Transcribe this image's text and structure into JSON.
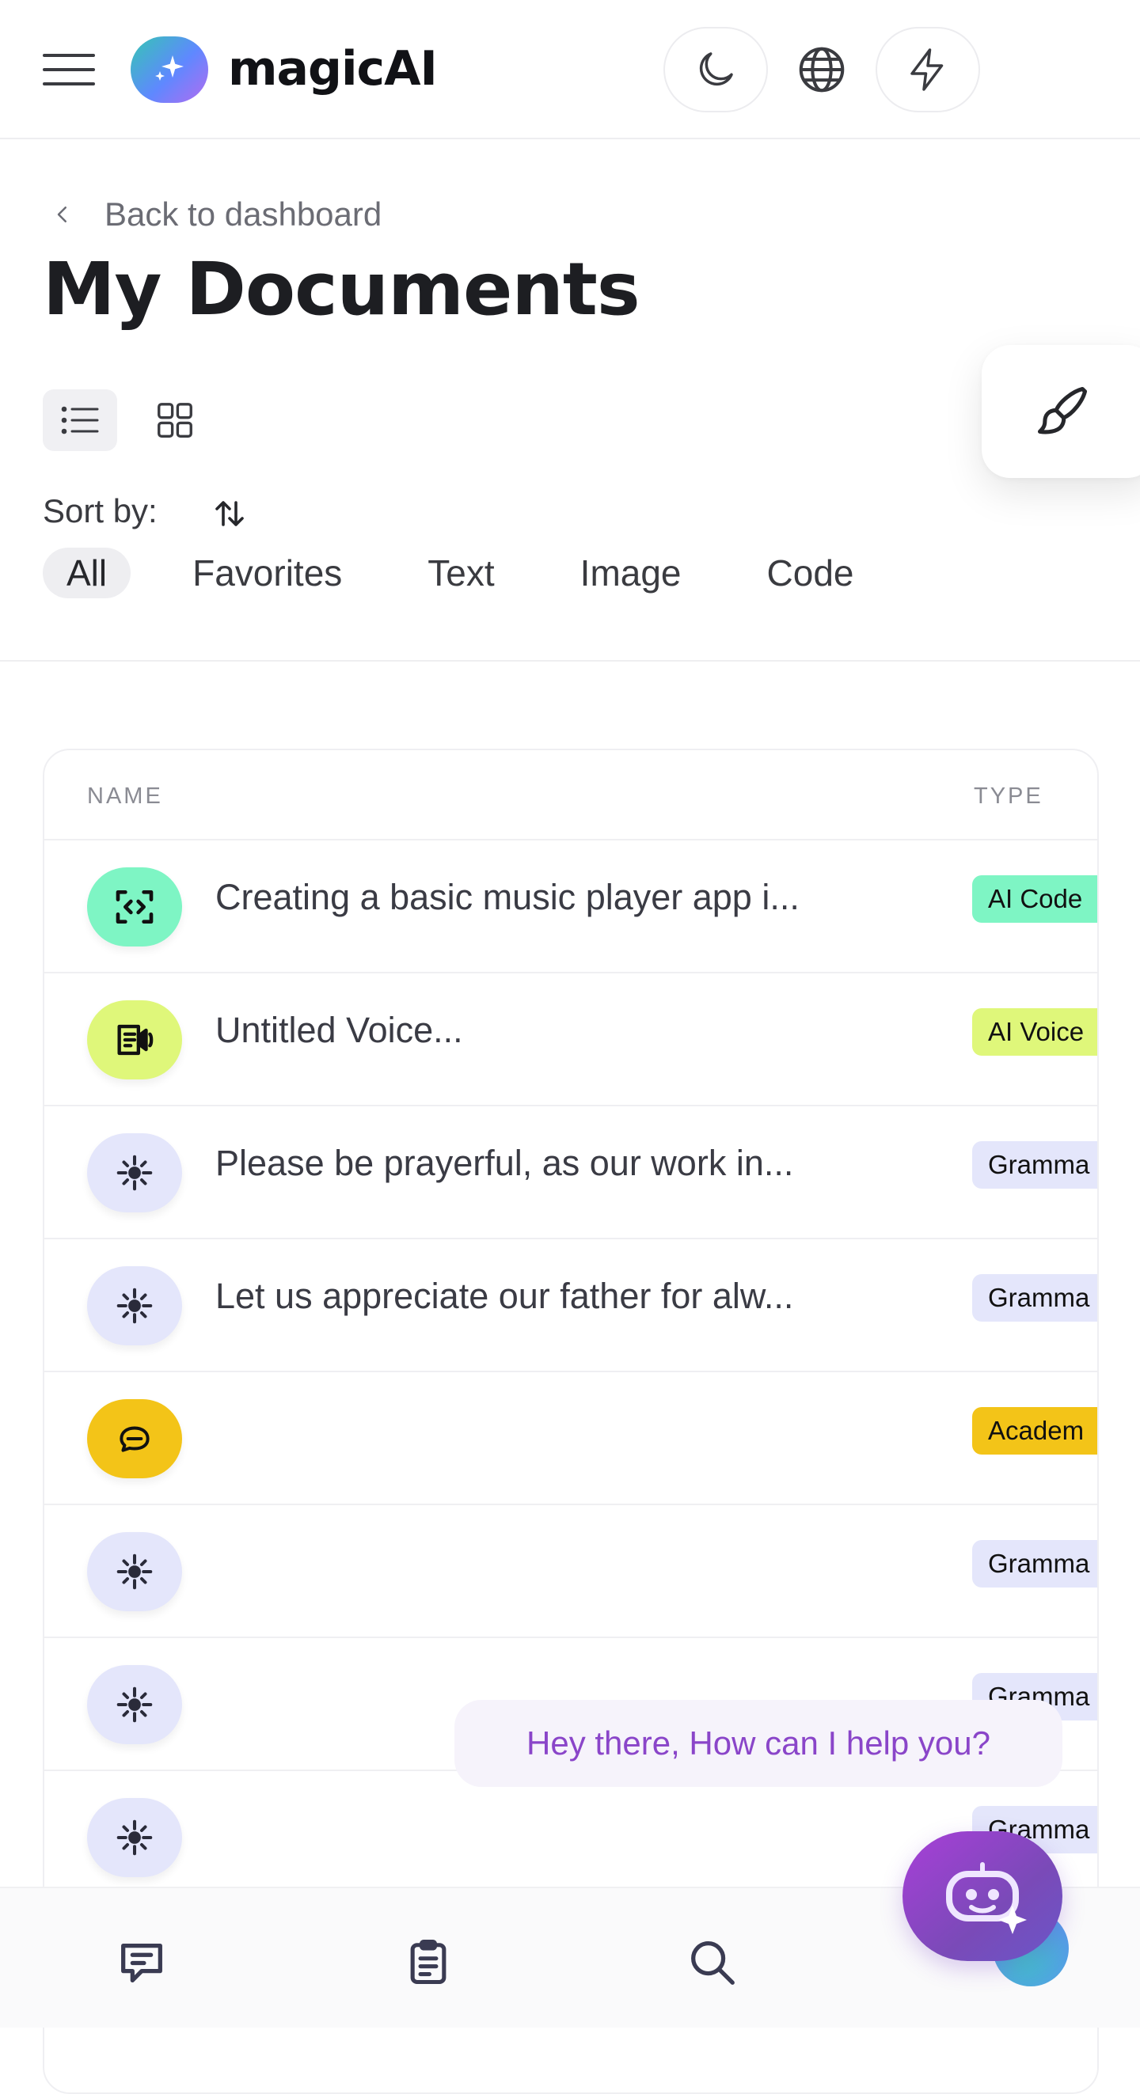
{
  "header": {
    "brand": "magicAI",
    "icons": [
      "menu-icon",
      "sparkle-logo-icon",
      "moon-icon",
      "globe-icon",
      "lightning-icon"
    ]
  },
  "page": {
    "back_label": "Back to dashboard",
    "title": "My Documents"
  },
  "toolbar": {
    "sort_label": "Sort by:",
    "view_modes": [
      "list",
      "grid"
    ],
    "active_view": "list"
  },
  "filters": [
    {
      "label": "All",
      "active": true
    },
    {
      "label": "Favorites",
      "active": false
    },
    {
      "label": "Text",
      "active": false
    },
    {
      "label": "Image",
      "active": false
    },
    {
      "label": "Code",
      "active": false
    }
  ],
  "table": {
    "columns": {
      "name": "NAME",
      "type": "TYPE"
    },
    "rows": [
      {
        "name": "Creating a basic music player app i...",
        "type": "AI Code Generator",
        "type_visible": "AI Code",
        "icon": "code-scan-icon",
        "color": "#7ef5c4"
      },
      {
        "name": "Untitled Voice...",
        "type": "AI Voiceover",
        "type_visible": "AI Voice",
        "icon": "voice-doc-icon",
        "color": "#dff77a"
      },
      {
        "name": "Please be prayerful, as our work in...",
        "type": "Grammar",
        "type_visible": "Gramma",
        "icon": "sun-spark-icon",
        "color": "#e4e6fb"
      },
      {
        "name": "Let us appreciate our father for alw...",
        "type": "Grammar",
        "type_visible": "Gramma",
        "icon": "sun-spark-icon",
        "color": "#e4e6fb"
      },
      {
        "name": "",
        "type": "Academic",
        "type_visible": "Academ",
        "icon": "chat-bubble-icon",
        "color": "#f3c418"
      },
      {
        "name": "",
        "type": "Grammar",
        "type_visible": "Gramma",
        "icon": "sun-spark-icon",
        "color": "#e4e6fb"
      },
      {
        "name": "",
        "type": "Grammar",
        "type_visible": "Gramma",
        "icon": "sun-spark-icon",
        "color": "#e4e6fb"
      },
      {
        "name": "",
        "type": "Grammar",
        "type_visible": "Gramma",
        "icon": "sun-spark-icon",
        "color": "#e4e6fb"
      }
    ]
  },
  "assistant": {
    "greeting": "Hey there, How can I help you?"
  },
  "bottom_nav": [
    "chat-icon",
    "clipboard-icon",
    "search-icon",
    "add-icon"
  ]
}
